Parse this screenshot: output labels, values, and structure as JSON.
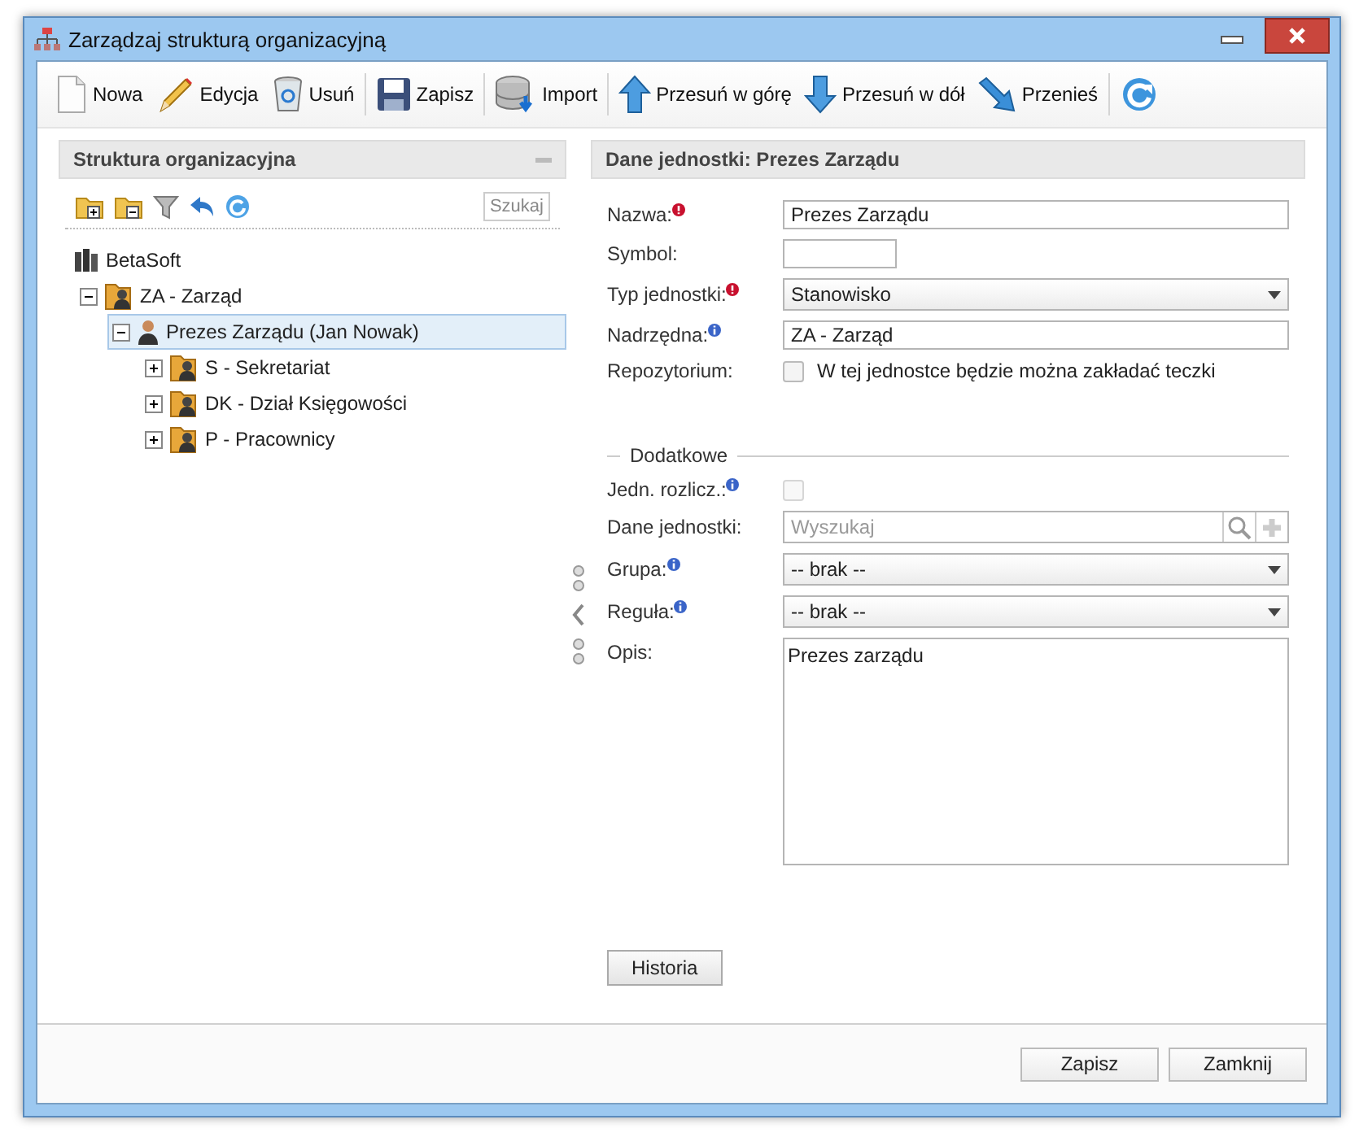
{
  "window": {
    "title": "Zarządzaj strukturą organizacyjną"
  },
  "toolbar": [
    [
      {
        "kind": "new",
        "label": "Nowa"
      },
      {
        "kind": "edit",
        "label": "Edycja"
      },
      {
        "kind": "delete",
        "label": "Usuń"
      }
    ],
    [
      {
        "kind": "save",
        "label": "Zapisz"
      }
    ],
    [
      {
        "kind": "import",
        "label": "Import"
      }
    ],
    [
      {
        "kind": "up",
        "label": "Przesuń w górę"
      },
      {
        "kind": "down",
        "label": "Przesuń w dół"
      },
      {
        "kind": "move",
        "label": "Przenieś"
      }
    ],
    [
      {
        "kind": "refresh"
      }
    ]
  ],
  "left_panel": {
    "title": "Struktura organizacyjna",
    "tools": [
      {
        "kind": "add-folder"
      },
      {
        "kind": "remove-folder"
      },
      {
        "kind": "filter"
      },
      {
        "kind": "undo"
      },
      {
        "kind": "refresh"
      }
    ],
    "search_button": "Szukaj",
    "tree": [
      {
        "kind": "root",
        "label": "BetaSoft",
        "children": [
          {
            "kind": "unit",
            "label": "ZA - Zarząd",
            "expanded": true,
            "selected": false,
            "children": [
              {
                "kind": "person",
                "label": "Prezes Zarządu (Jan Nowak)",
                "expanded": true,
                "selected": true,
                "children": [
                  {
                    "kind": "unit",
                    "label": "S - Sekretariat",
                    "expanded": false,
                    "selected": false
                  },
                  {
                    "kind": "unit",
                    "label": "DK - Dział Księgowości",
                    "expanded": false,
                    "selected": false
                  },
                  {
                    "kind": "unit",
                    "label": "P - Pracownicy",
                    "expanded": false,
                    "selected": false
                  }
                ]
              }
            ]
          }
        ]
      }
    ]
  },
  "right_panel": {
    "title": "Dane jednostki: Prezes Zarządu",
    "fields": [
      {
        "kind": "text",
        "label": "Nazwa:",
        "required": true,
        "info": false,
        "value": "Prezes Zarządu"
      },
      {
        "kind": "short",
        "label": "Symbol:",
        "required": false,
        "info": false
      },
      {
        "kind": "select",
        "label": "Typ jednostki:",
        "required": true,
        "info": false,
        "value": "Stanowisko"
      },
      {
        "kind": "text",
        "label": "Nadrzędna:",
        "required": false,
        "info": true,
        "value": "ZA - Zarząd"
      },
      {
        "kind": "checkbox",
        "label": "Repozytorium:",
        "required": false,
        "info": false,
        "checked": false,
        "text": "W tej jednostce będzie można zakładać teczki"
      }
    ],
    "section": {
      "title": "Dodatkowe",
      "fields": [
        {
          "kind": "checkbox",
          "label": "Jedn. rozlicz.:",
          "required": false,
          "info": true,
          "checked": false,
          "disabled": true
        },
        {
          "kind": "search",
          "label": "Dane jednostki:",
          "required": false,
          "info": false,
          "placeholder": "Wyszukaj"
        },
        {
          "kind": "select",
          "label": "Grupa:",
          "required": false,
          "info": true,
          "value": "-- brak --"
        },
        {
          "kind": "select",
          "label": "Reguła:",
          "required": false,
          "info": true,
          "value": "-- brak --"
        },
        {
          "kind": "textarea",
          "label": "Opis:",
          "required": false,
          "info": false,
          "value": "Prezes zarządu"
        }
      ]
    },
    "history_button": "Historia"
  },
  "footer": {
    "buttons": [
      "Zapisz",
      "Zamknij"
    ]
  }
}
